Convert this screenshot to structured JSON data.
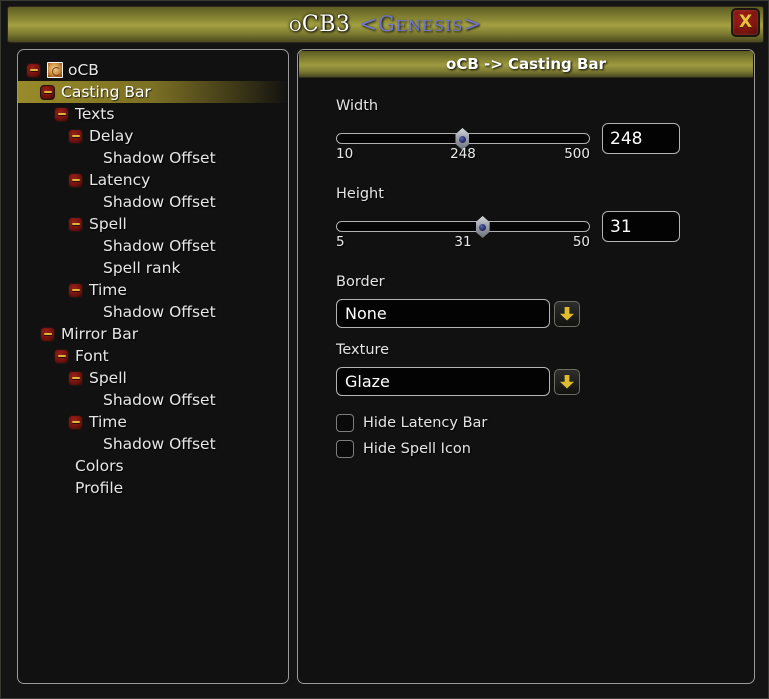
{
  "window": {
    "title_main": "oCB3",
    "title_guild": "<Genesis>",
    "close_label": "X"
  },
  "tree": {
    "items": [
      {
        "label": "oCB",
        "depth": 0,
        "expander": "minus",
        "icon": "addon-icon",
        "selected": false
      },
      {
        "label": "Casting Bar",
        "depth": 1,
        "expander": "minus",
        "icon": "",
        "selected": true
      },
      {
        "label": "Texts",
        "depth": 2,
        "expander": "minus",
        "icon": "",
        "selected": false
      },
      {
        "label": "Delay",
        "depth": 3,
        "expander": "minus",
        "icon": "",
        "selected": false
      },
      {
        "label": "Shadow Offset",
        "depth": 4,
        "expander": "none",
        "icon": "",
        "selected": false
      },
      {
        "label": "Latency",
        "depth": 3,
        "expander": "minus",
        "icon": "",
        "selected": false
      },
      {
        "label": "Shadow Offset",
        "depth": 4,
        "expander": "none",
        "icon": "",
        "selected": false
      },
      {
        "label": "Spell",
        "depth": 3,
        "expander": "minus",
        "icon": "",
        "selected": false
      },
      {
        "label": "Shadow Offset",
        "depth": 4,
        "expander": "none",
        "icon": "",
        "selected": false
      },
      {
        "label": "Spell rank",
        "depth": 4,
        "expander": "none",
        "icon": "",
        "selected": false
      },
      {
        "label": "Time",
        "depth": 3,
        "expander": "minus",
        "icon": "",
        "selected": false
      },
      {
        "label": "Shadow Offset",
        "depth": 4,
        "expander": "none",
        "icon": "",
        "selected": false
      },
      {
        "label": "Mirror Bar",
        "depth": 1,
        "expander": "minus",
        "icon": "",
        "selected": false
      },
      {
        "label": "Font",
        "depth": 2,
        "expander": "minus",
        "icon": "",
        "selected": false
      },
      {
        "label": "Spell",
        "depth": 3,
        "expander": "minus",
        "icon": "",
        "selected": false
      },
      {
        "label": "Shadow Offset",
        "depth": 4,
        "expander": "none",
        "icon": "",
        "selected": false
      },
      {
        "label": "Time",
        "depth": 3,
        "expander": "minus",
        "icon": "",
        "selected": false
      },
      {
        "label": "Shadow Offset",
        "depth": 4,
        "expander": "none",
        "icon": "",
        "selected": false
      },
      {
        "label": "Colors",
        "depth": 2,
        "expander": "none",
        "icon": "",
        "selected": false
      },
      {
        "label": "Profile",
        "depth": 2,
        "expander": "none",
        "icon": "",
        "selected": false
      }
    ]
  },
  "content": {
    "header": "oCB -> Casting Bar",
    "width_slider": {
      "label": "Width",
      "min": "10",
      "max": "500",
      "current": "248",
      "value": "248",
      "percent": 49.8
    },
    "height_slider": {
      "label": "Height",
      "min": "5",
      "max": "50",
      "current": "31",
      "value": "31",
      "percent": 57.8
    },
    "border_dropdown": {
      "label": "Border",
      "value": "None",
      "arrow": "chevron-down-icon"
    },
    "texture_dropdown": {
      "label": "Texture",
      "value": "Glaze",
      "arrow": "chevron-down-icon"
    },
    "checkboxes": [
      {
        "label": "Hide Latency Bar",
        "checked": false
      },
      {
        "label": "Hide Spell Icon",
        "checked": false
      }
    ]
  },
  "colors": {
    "title_gold": "#a3a042",
    "guild_blue": "#6f76d6",
    "accent_gold": "#e0bc2c",
    "close_red": "#7c1410",
    "panel_bg": "#111111",
    "panel_border": "#9a9a9a"
  }
}
